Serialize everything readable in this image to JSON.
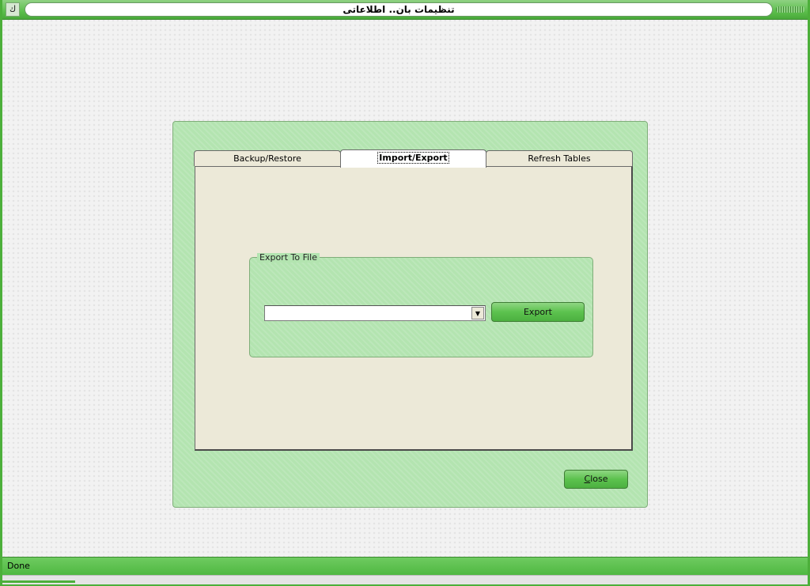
{
  "window": {
    "title": "تنظیمات بان.. اطلاعاتی",
    "system_icon": "ك"
  },
  "tabs": [
    {
      "label": "Backup/Restore",
      "active": false
    },
    {
      "label": "Import/Export",
      "active": true
    },
    {
      "label": "Refresh Tables",
      "active": false
    }
  ],
  "export_group": {
    "legend": "Export To File",
    "combo_value": "",
    "export_label": "Export"
  },
  "footer": {
    "close_prefix": "",
    "close_mnemonic": "C",
    "close_rest": "lose"
  },
  "status": {
    "text": "Done"
  },
  "colors": {
    "accent": "#5cbf4c",
    "panel": "#b3e4b0",
    "tab_body": "#ece9d8"
  }
}
